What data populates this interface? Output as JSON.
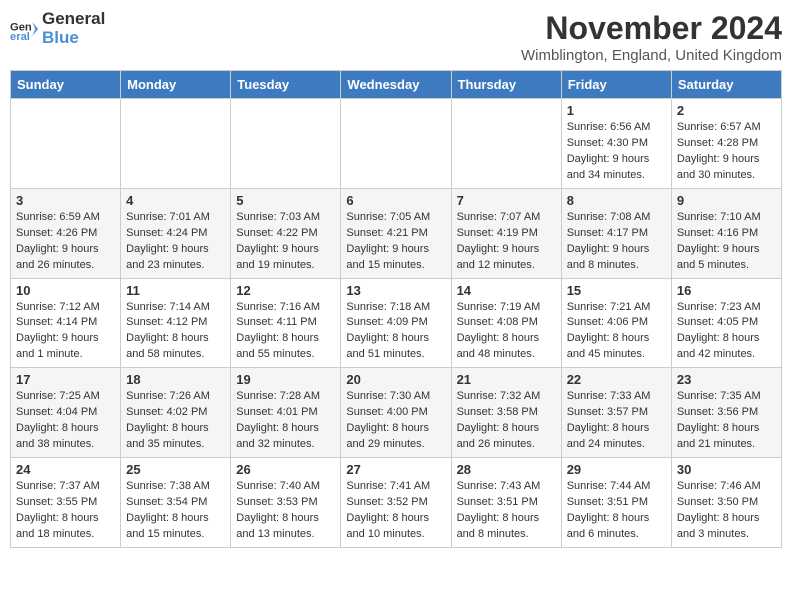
{
  "header": {
    "logo_line1": "General",
    "logo_line2": "Blue",
    "month_title": "November 2024",
    "location": "Wimblington, England, United Kingdom"
  },
  "days_of_week": [
    "Sunday",
    "Monday",
    "Tuesday",
    "Wednesday",
    "Thursday",
    "Friday",
    "Saturday"
  ],
  "weeks": [
    [
      {
        "day": "",
        "info": ""
      },
      {
        "day": "",
        "info": ""
      },
      {
        "day": "",
        "info": ""
      },
      {
        "day": "",
        "info": ""
      },
      {
        "day": "",
        "info": ""
      },
      {
        "day": "1",
        "info": "Sunrise: 6:56 AM\nSunset: 4:30 PM\nDaylight: 9 hours\nand 34 minutes."
      },
      {
        "day": "2",
        "info": "Sunrise: 6:57 AM\nSunset: 4:28 PM\nDaylight: 9 hours\nand 30 minutes."
      }
    ],
    [
      {
        "day": "3",
        "info": "Sunrise: 6:59 AM\nSunset: 4:26 PM\nDaylight: 9 hours\nand 26 minutes."
      },
      {
        "day": "4",
        "info": "Sunrise: 7:01 AM\nSunset: 4:24 PM\nDaylight: 9 hours\nand 23 minutes."
      },
      {
        "day": "5",
        "info": "Sunrise: 7:03 AM\nSunset: 4:22 PM\nDaylight: 9 hours\nand 19 minutes."
      },
      {
        "day": "6",
        "info": "Sunrise: 7:05 AM\nSunset: 4:21 PM\nDaylight: 9 hours\nand 15 minutes."
      },
      {
        "day": "7",
        "info": "Sunrise: 7:07 AM\nSunset: 4:19 PM\nDaylight: 9 hours\nand 12 minutes."
      },
      {
        "day": "8",
        "info": "Sunrise: 7:08 AM\nSunset: 4:17 PM\nDaylight: 9 hours\nand 8 minutes."
      },
      {
        "day": "9",
        "info": "Sunrise: 7:10 AM\nSunset: 4:16 PM\nDaylight: 9 hours\nand 5 minutes."
      }
    ],
    [
      {
        "day": "10",
        "info": "Sunrise: 7:12 AM\nSunset: 4:14 PM\nDaylight: 9 hours\nand 1 minute."
      },
      {
        "day": "11",
        "info": "Sunrise: 7:14 AM\nSunset: 4:12 PM\nDaylight: 8 hours\nand 58 minutes."
      },
      {
        "day": "12",
        "info": "Sunrise: 7:16 AM\nSunset: 4:11 PM\nDaylight: 8 hours\nand 55 minutes."
      },
      {
        "day": "13",
        "info": "Sunrise: 7:18 AM\nSunset: 4:09 PM\nDaylight: 8 hours\nand 51 minutes."
      },
      {
        "day": "14",
        "info": "Sunrise: 7:19 AM\nSunset: 4:08 PM\nDaylight: 8 hours\nand 48 minutes."
      },
      {
        "day": "15",
        "info": "Sunrise: 7:21 AM\nSunset: 4:06 PM\nDaylight: 8 hours\nand 45 minutes."
      },
      {
        "day": "16",
        "info": "Sunrise: 7:23 AM\nSunset: 4:05 PM\nDaylight: 8 hours\nand 42 minutes."
      }
    ],
    [
      {
        "day": "17",
        "info": "Sunrise: 7:25 AM\nSunset: 4:04 PM\nDaylight: 8 hours\nand 38 minutes."
      },
      {
        "day": "18",
        "info": "Sunrise: 7:26 AM\nSunset: 4:02 PM\nDaylight: 8 hours\nand 35 minutes."
      },
      {
        "day": "19",
        "info": "Sunrise: 7:28 AM\nSunset: 4:01 PM\nDaylight: 8 hours\nand 32 minutes."
      },
      {
        "day": "20",
        "info": "Sunrise: 7:30 AM\nSunset: 4:00 PM\nDaylight: 8 hours\nand 29 minutes."
      },
      {
        "day": "21",
        "info": "Sunrise: 7:32 AM\nSunset: 3:58 PM\nDaylight: 8 hours\nand 26 minutes."
      },
      {
        "day": "22",
        "info": "Sunrise: 7:33 AM\nSunset: 3:57 PM\nDaylight: 8 hours\nand 24 minutes."
      },
      {
        "day": "23",
        "info": "Sunrise: 7:35 AM\nSunset: 3:56 PM\nDaylight: 8 hours\nand 21 minutes."
      }
    ],
    [
      {
        "day": "24",
        "info": "Sunrise: 7:37 AM\nSunset: 3:55 PM\nDaylight: 8 hours\nand 18 minutes."
      },
      {
        "day": "25",
        "info": "Sunrise: 7:38 AM\nSunset: 3:54 PM\nDaylight: 8 hours\nand 15 minutes."
      },
      {
        "day": "26",
        "info": "Sunrise: 7:40 AM\nSunset: 3:53 PM\nDaylight: 8 hours\nand 13 minutes."
      },
      {
        "day": "27",
        "info": "Sunrise: 7:41 AM\nSunset: 3:52 PM\nDaylight: 8 hours\nand 10 minutes."
      },
      {
        "day": "28",
        "info": "Sunrise: 7:43 AM\nSunset: 3:51 PM\nDaylight: 8 hours\nand 8 minutes."
      },
      {
        "day": "29",
        "info": "Sunrise: 7:44 AM\nSunset: 3:51 PM\nDaylight: 8 hours\nand 6 minutes."
      },
      {
        "day": "30",
        "info": "Sunrise: 7:46 AM\nSunset: 3:50 PM\nDaylight: 8 hours\nand 3 minutes."
      }
    ]
  ]
}
